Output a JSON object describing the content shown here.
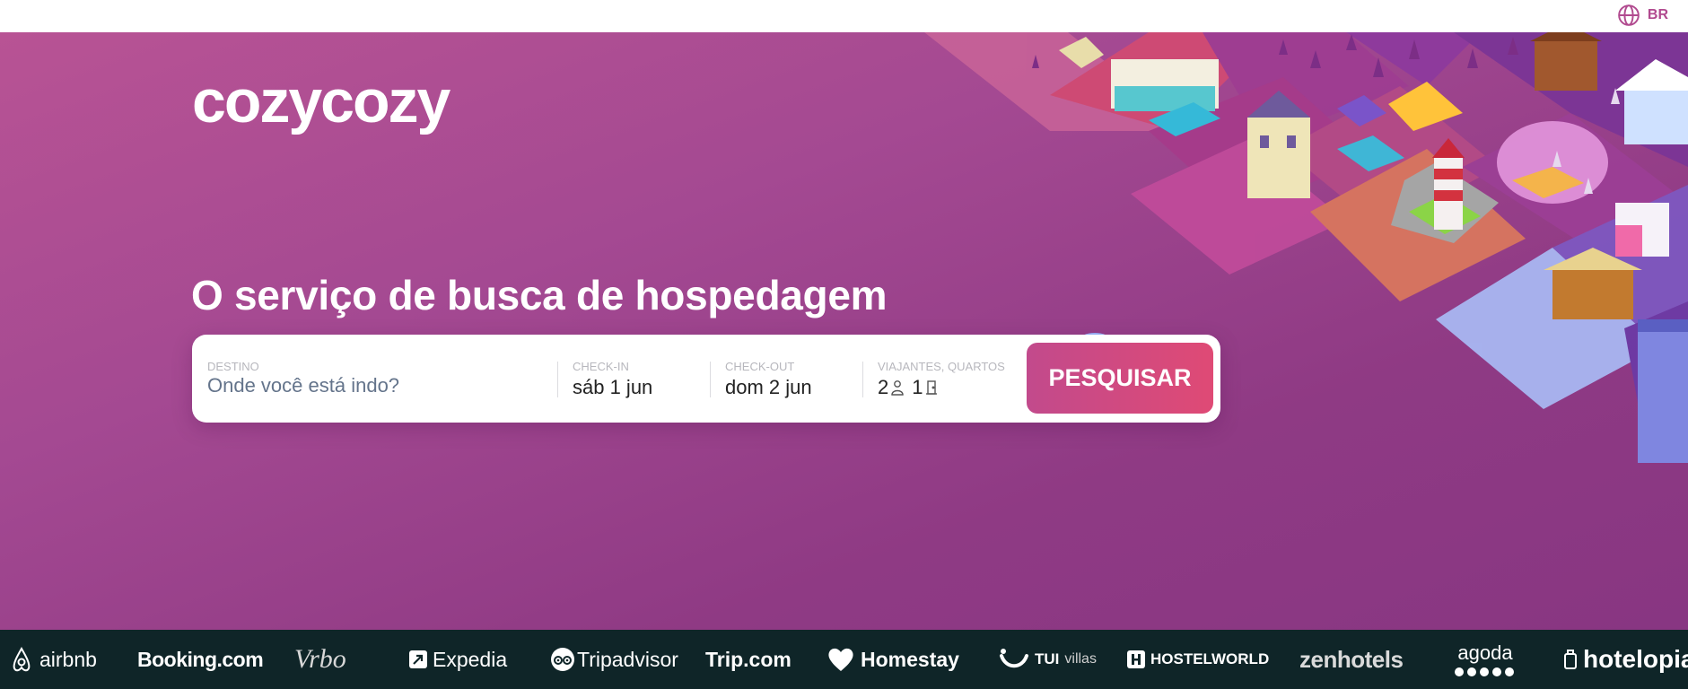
{
  "header": {
    "language_code": "BR",
    "language_icon": "globe-icon"
  },
  "brand": {
    "logo_text": "cozycozy"
  },
  "hero": {
    "headline": "O serviço de busca de hospedagem"
  },
  "search": {
    "destination": {
      "label": "DESTINO",
      "placeholder": "Onde você está indo?",
      "value": ""
    },
    "checkin": {
      "label": "CHECK-IN",
      "value": "sáb 1 jun"
    },
    "checkout": {
      "label": "CHECK-OUT",
      "value": "dom 2 jun"
    },
    "guests": {
      "label": "VIAJANTES, QUARTOS",
      "travelers": "2",
      "rooms": "1"
    },
    "button_label": "PESQUISAR"
  },
  "partners": [
    {
      "name": "airbnb",
      "icon": "airbnb-icon"
    },
    {
      "name": "Booking.com"
    },
    {
      "name": "Vrbo"
    },
    {
      "name": "Expedia",
      "icon": "expedia-icon"
    },
    {
      "name": "Tripadvisor",
      "icon": "tripadvisor-icon"
    },
    {
      "name": "Trip.com"
    },
    {
      "name": "Homestay",
      "icon": "heart-icon"
    },
    {
      "name": "TUI",
      "suffix": "villas",
      "icon": "tui-smile-icon"
    },
    {
      "name": "HOSTELWORLD",
      "icon": "hostelworld-icon"
    },
    {
      "name": "zenhotels"
    },
    {
      "name": "agoda"
    },
    {
      "name": "hotelopia",
      "icon": "luggage-icon"
    }
  ],
  "colors": {
    "accent": "#b14a8f",
    "hero_start": "#b85394",
    "hero_end": "#883682",
    "button_start": "#c24a8c",
    "button_end": "#df4a75",
    "footer_bg": "#0f2528"
  }
}
